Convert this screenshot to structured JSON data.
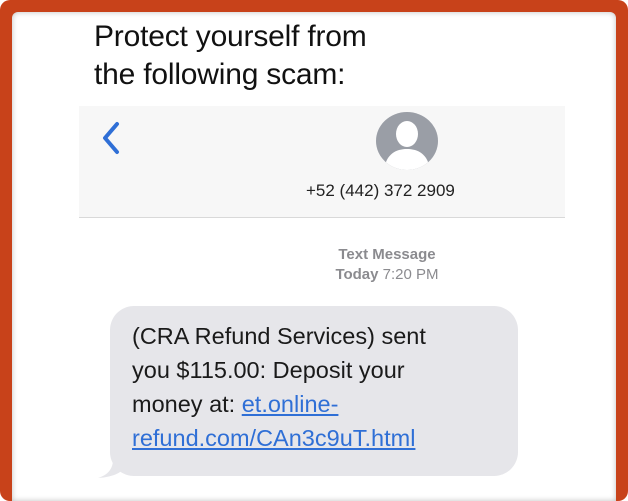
{
  "heading": {
    "line1": "Protect yourself from",
    "line2": "the following scam:"
  },
  "header": {
    "phone_number": "+52 (442) 372 2909",
    "back_icon": "chevron-left-icon",
    "avatar_icon": "person-silhouette-icon"
  },
  "thread": {
    "label": "Text Message",
    "day": "Today",
    "time": "7:20 PM"
  },
  "message": {
    "line1": "(CRA Refund Services) sent",
    "line2": "you $115.00: Deposit your",
    "line3_text": "money at: ",
    "link_part1": "et.online-",
    "link_part2": "refund.com/CAn3c9uT.html"
  },
  "colors": {
    "frame": "#c8421a",
    "ios_blue": "#2f6fd6",
    "bubble": "#e6e6ea",
    "meta_text": "#8b8b8f"
  }
}
